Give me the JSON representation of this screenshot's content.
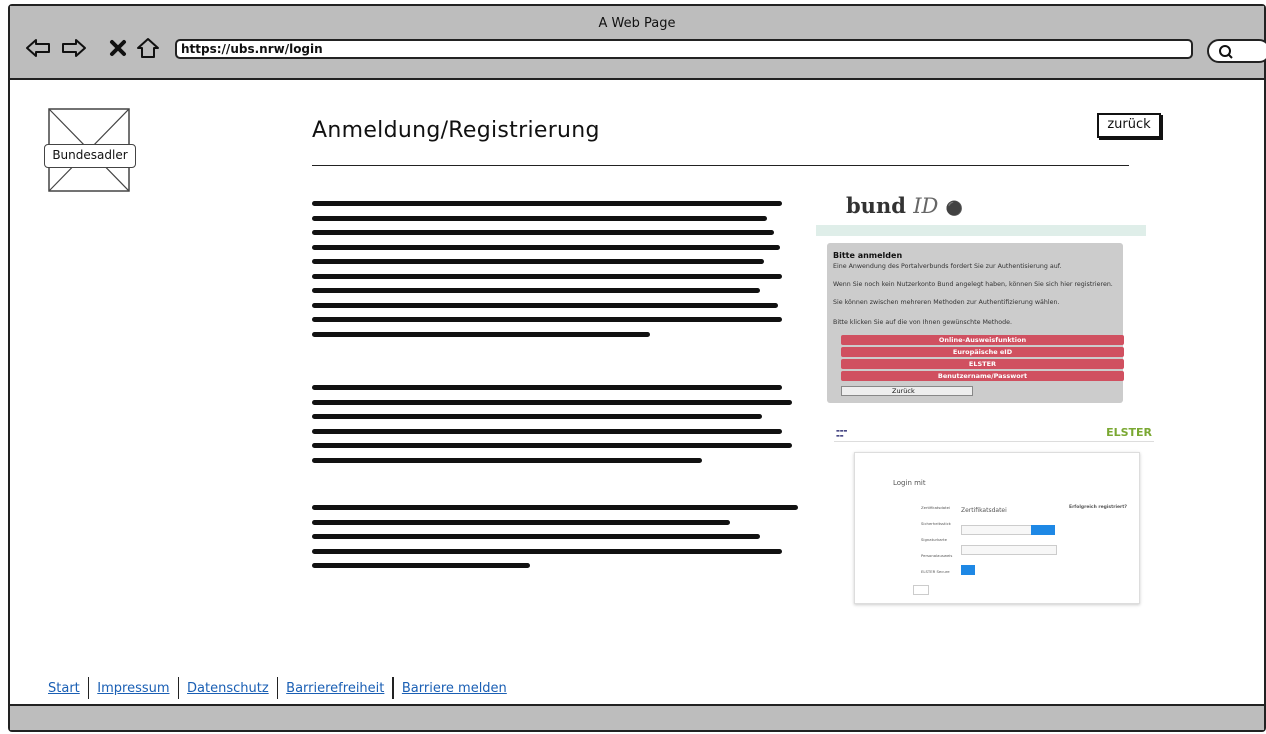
{
  "window": {
    "title": "A Web Page",
    "url": "https://ubs.nrw/login"
  },
  "logo": {
    "label": "Bundesadler"
  },
  "page": {
    "title": "Anmeldung/Registrierung",
    "back_label": "zurück"
  },
  "bund": {
    "logo": "bund",
    "logo_id": "ID",
    "heading": "Bitte anmelden",
    "texts": [
      "Eine Anwendung des Portalverbunds fordert Sie zur Authentisierung auf.",
      "Wenn Sie noch kein Nutzerkonto Bund angelegt haben, können Sie sich hier registrieren.",
      "Sie können zwischen mehreren Methoden zur Authentifizierung wählen.",
      "Bitte klicken Sie auf die von Ihnen gewünschte Methode."
    ],
    "buttons": [
      "Online-Ausweisfunktion",
      "Europäische eID",
      "ELSTER",
      "Benutzername/Passwort"
    ],
    "back": "Zurück"
  },
  "elster": {
    "brand": "ELSTER",
    "login_title": "Login mit",
    "cert_title": "Zertifikatsdatei",
    "tabs": [
      "Zertifikatsdatei",
      "Sicherheitsstick",
      "Signaturkarte",
      "Personalausweis",
      "ELSTER Secure"
    ],
    "info_title": "Erfolgreich registriert?"
  },
  "footer": {
    "links": [
      "Start",
      "Impressum",
      "Datenschutz",
      "Barrierefreiheit",
      "Barriere melden"
    ]
  }
}
